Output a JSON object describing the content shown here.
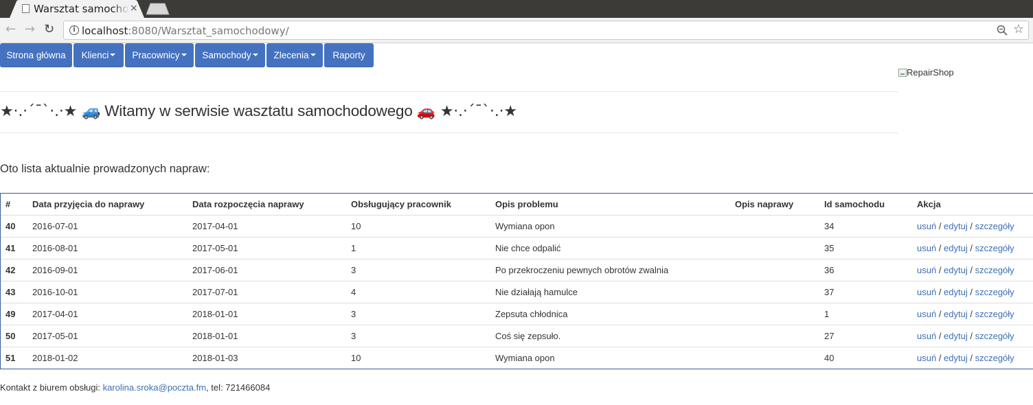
{
  "browser": {
    "tab_title": "Warsztat samochodowy",
    "close_glyph": "×",
    "url_host": "localhost",
    "url_rest": ":8080/Warsztat_samochodowy/",
    "back_glyph": "←",
    "forward_glyph": "→",
    "reload_glyph": "↻",
    "info_glyph": "i",
    "star_glyph": "☆"
  },
  "nav": {
    "home": "Strona główna",
    "clients": "Klienci",
    "employees": "Pracownicy",
    "cars": "Samochody",
    "orders": "Zlecenia",
    "reports": "Raporty"
  },
  "logo_alt": "RepairShop",
  "welcome": {
    "left_deco": "★·.·´¯`·.·★ ",
    "car_left": "🚙",
    "text": " Witamy w serwisie wasztatu samochodowego ",
    "car_right": "🚗",
    "right_deco": " ★·.·´¯`·.·★"
  },
  "intro": "Oto lista aktualnie prowadzonych napraw:",
  "table": {
    "headers": {
      "id": "#",
      "accepted": "Data przyjęcia do naprawy",
      "started": "Data rozpoczęcia naprawy",
      "employee": "Obsługujący pracownik",
      "problem": "Opis problemu",
      "repair": "Opis naprawy",
      "car_id": "Id samochodu",
      "action": "Akcja"
    },
    "actions": {
      "delete": "usuń",
      "edit": "edytuj",
      "details": "szczegóły",
      "sep": " / "
    },
    "rows": [
      {
        "id": "40",
        "accepted": "2016-07-01",
        "started": "2017-04-01",
        "employee": "10",
        "problem": "Wymiana opon",
        "repair": "",
        "car_id": "34"
      },
      {
        "id": "41",
        "accepted": "2016-08-01",
        "started": "2017-05-01",
        "employee": "1",
        "problem": "Nie chce odpalić",
        "repair": "",
        "car_id": "35"
      },
      {
        "id": "42",
        "accepted": "2016-09-01",
        "started": "2017-06-01",
        "employee": "3",
        "problem": "Po przekroczeniu pewnych obrotów zwalnia",
        "repair": "",
        "car_id": "36"
      },
      {
        "id": "43",
        "accepted": "2016-10-01",
        "started": "2017-07-01",
        "employee": "4",
        "problem": "Nie działają hamulce",
        "repair": "",
        "car_id": "37"
      },
      {
        "id": "49",
        "accepted": "2017-04-01",
        "started": "2018-01-01",
        "employee": "3",
        "problem": "Zepsuta chłodnica",
        "repair": "",
        "car_id": "1"
      },
      {
        "id": "50",
        "accepted": "2017-05-01",
        "started": "2018-01-01",
        "employee": "3",
        "problem": "Coś się zepsuło.",
        "repair": "",
        "car_id": "27"
      },
      {
        "id": "51",
        "accepted": "2018-01-02",
        "started": "2018-01-03",
        "employee": "10",
        "problem": "Wymiana opon",
        "repair": "",
        "car_id": "40"
      }
    ]
  },
  "footer": {
    "prefix": "Kontakt z biurem obsługi: ",
    "email": "karolina.sroka@poczta.fm",
    "suffix": ", tel: 721466084"
  },
  "colors": {
    "nav_bg": "#4472c0",
    "link": "#3d6fb4",
    "table_border": "#3b5998"
  }
}
